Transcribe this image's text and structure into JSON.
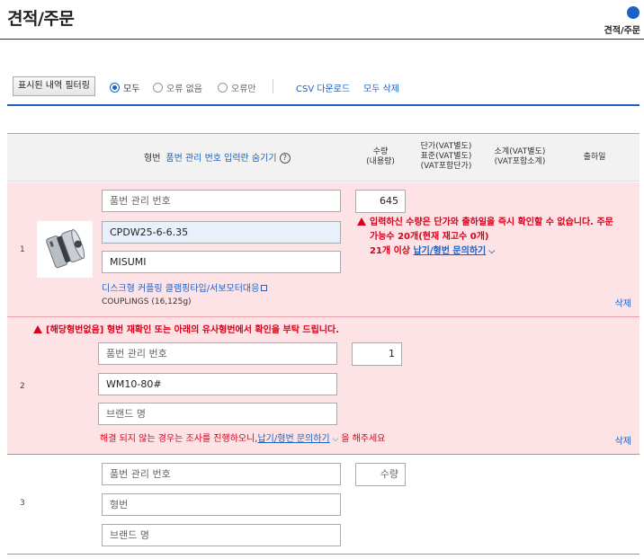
{
  "page": {
    "title": "견적/주문",
    "step_label": "견적/주문"
  },
  "toolbar": {
    "filter_button": "표시된 내역 필터링",
    "radio_all": "모두",
    "radio_no_error": "오류 없음",
    "radio_error_only": "오류만",
    "csv_download": "CSV 다운로드",
    "delete_all": "모두 삭제"
  },
  "table_header": {
    "part_number": "형번",
    "hide_toggle": "품번 관리 번호 입력란 숨기기",
    "help_glyph": "?",
    "qty_line1": "수량",
    "qty_line2": "(내용량)",
    "price_line1": "단가(VAT별도)",
    "price_line2": "표준(VAT별도)",
    "price_line3": "(VAT포함단가)",
    "subtotal_line1": "소계(VAT별도)",
    "subtotal_line2": "(VAT포함소계)",
    "ship_date": "출하일"
  },
  "rows": [
    {
      "index": "1",
      "mgmt_placeholder": "품번 관리 번호",
      "part_number": "CPDW25-6-6.35",
      "brand": "MISUMI",
      "quantity": "645",
      "product_name": "디스크형 커플링 클램핑타입/서보모터대응",
      "category": "COUPLINGS (16,125g)",
      "error_line1": "입력하신 수량은 단가와 출하일을 즉시 확인할 수 없습니다. 주문",
      "error_line2": "가능수 20개(현재 재고수 0개)",
      "error_line3_prefix": "21개 이상",
      "error_link": "납기/형번 문의하기",
      "delete": "삭제"
    },
    {
      "index": "2",
      "warning": "[해당형번없음] 형번 재확인 또는 아래의 유사형번에서 확인을 부탁 드립니다.",
      "mgmt_placeholder": "품번 관리 번호",
      "part_number": "WM10-80#",
      "brand_placeholder": "브랜드 명",
      "quantity": "1",
      "footer_prefix": "해결 되지 않는 경우는 조사를 진행하오니,",
      "footer_link": "납기/형번 문의하기",
      "footer_suffix": "을 해주세요",
      "delete": "삭제"
    },
    {
      "index": "3",
      "mgmt_placeholder": "품번 관리 번호",
      "part_number_placeholder": "형번",
      "brand_placeholder": "브랜드 명",
      "quantity_placeholder": "수량"
    }
  ],
  "colors": {
    "accent": "#1b62c4",
    "error": "#d8001a",
    "error_row_bg": "#fde3e5"
  }
}
